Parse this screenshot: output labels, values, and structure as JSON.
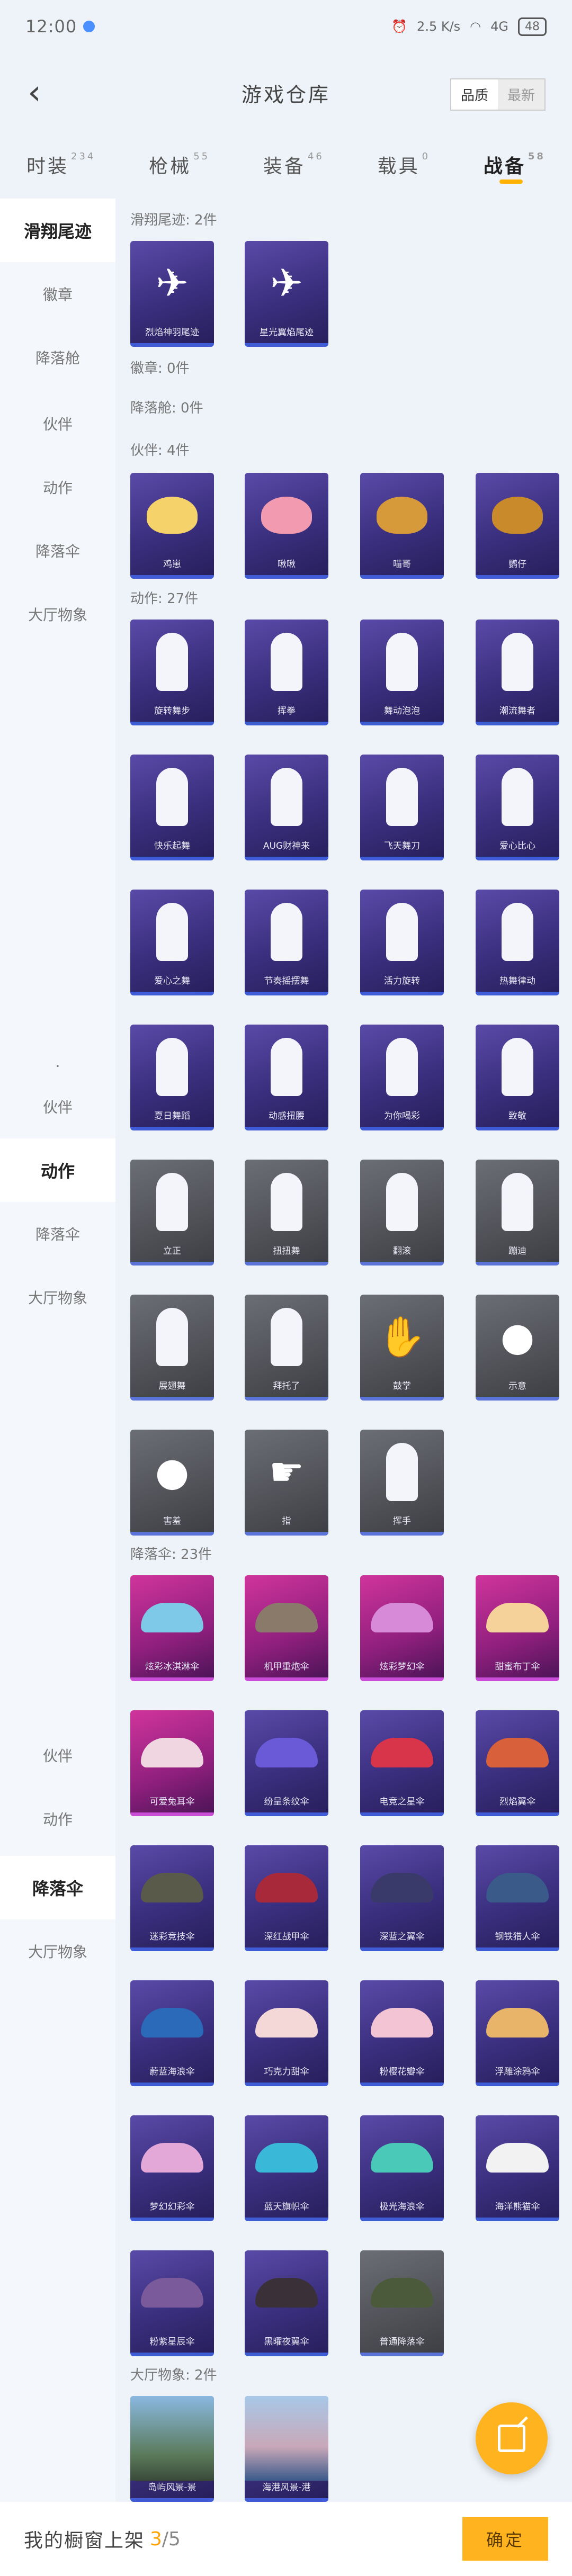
{
  "status": {
    "time": "12:00",
    "speed": "2.5 K/s",
    "network": "4G",
    "battery": "48"
  },
  "header": {
    "title": "游戏仓库",
    "back_icon": "back-chevron-icon",
    "sort": {
      "quality": "品质",
      "latest": "最新"
    }
  },
  "tabs": [
    {
      "label": "时装",
      "count": "234"
    },
    {
      "label": "枪械",
      "count": "55"
    },
    {
      "label": "装备",
      "count": "46"
    },
    {
      "label": "载具",
      "count": "0"
    },
    {
      "label": "战备",
      "count": "58"
    }
  ],
  "sidebar": [
    {
      "label": "滑翔尾迹"
    },
    {
      "label": "徽章"
    },
    {
      "label": "降落舱"
    },
    {
      "label": "伙伴"
    },
    {
      "label": "动作"
    },
    {
      "label": "降落伞"
    },
    {
      "label": "大厅物象"
    },
    {
      "label": "."
    },
    {
      "label": "伙伴"
    },
    {
      "label": "动作"
    },
    {
      "label": "降落伞"
    },
    {
      "label": "大厅物象"
    },
    {
      "label": "伙伴"
    },
    {
      "label": "动作"
    },
    {
      "label": "降落伞"
    },
    {
      "label": "大厅物象"
    }
  ],
  "sections": {
    "glide": {
      "title": "滑翔尾迹: 2件",
      "items": [
        "烈焰神羽尾迹",
        "星光翼焰尾迹"
      ]
    },
    "badge": {
      "title": "徽章: 0件"
    },
    "pod": {
      "title": "降落舱: 0件"
    },
    "partner": {
      "title": "伙伴: 4件",
      "items": [
        "鸡崽",
        "啾啾",
        "喵哥",
        "鹦仔"
      ]
    },
    "emote": {
      "title": "动作: 27件",
      "items": [
        "旋转舞步",
        "挥拳",
        "舞动泡泡",
        "潮流舞者",
        "快乐起舞",
        "AUG财神来",
        "飞天舞刀",
        "爱心比心",
        "爱心之舞",
        "节奏摇摆舞",
        "活力旋转",
        "热舞律动",
        "夏日舞蹈",
        "动感扭腰",
        "为你喝彩",
        "致敬",
        "立正",
        "扭扭舞",
        "翻滚",
        "蹦迪",
        "展翅舞",
        "拜托了",
        "鼓掌",
        "示意",
        "害羞",
        "指",
        "挥手"
      ]
    },
    "parachute": {
      "title": "降落伞: 23件",
      "items": [
        "炫彩冰淇淋伞",
        "机甲重炮伞",
        "炫彩梦幻伞",
        "甜蜜布丁伞",
        "可爱兔耳伞",
        "纷呈条纹伞",
        "电竞之星伞",
        "烈焰翼伞",
        "迷彩竞技伞",
        "深红战甲伞",
        "深蓝之翼伞",
        "钢铁猎人伞",
        "蔚蓝海浪伞",
        "巧克力甜伞",
        "粉樱花瓣伞",
        "浮雕涂鸦伞",
        "梦幻幻彩伞",
        "蓝天旗帜伞",
        "极光海浪伞",
        "海洋熊猫伞",
        "粉紫星辰伞",
        "黑曜夜翼伞",
        "普通降落伞"
      ]
    },
    "lobby": {
      "title": "大厅物象: 2件",
      "items": [
        "岛屿风景-景",
        "海港风景-港"
      ]
    }
  },
  "bottom": {
    "label": "我的橱窗上架",
    "count": "3",
    "total": "/5",
    "confirm": "确定"
  },
  "colors": {
    "accent": "#ffb41f",
    "purple_card": "#3a2f7e",
    "pink_card": "#8f1f7d",
    "gray_card": "#505258"
  }
}
